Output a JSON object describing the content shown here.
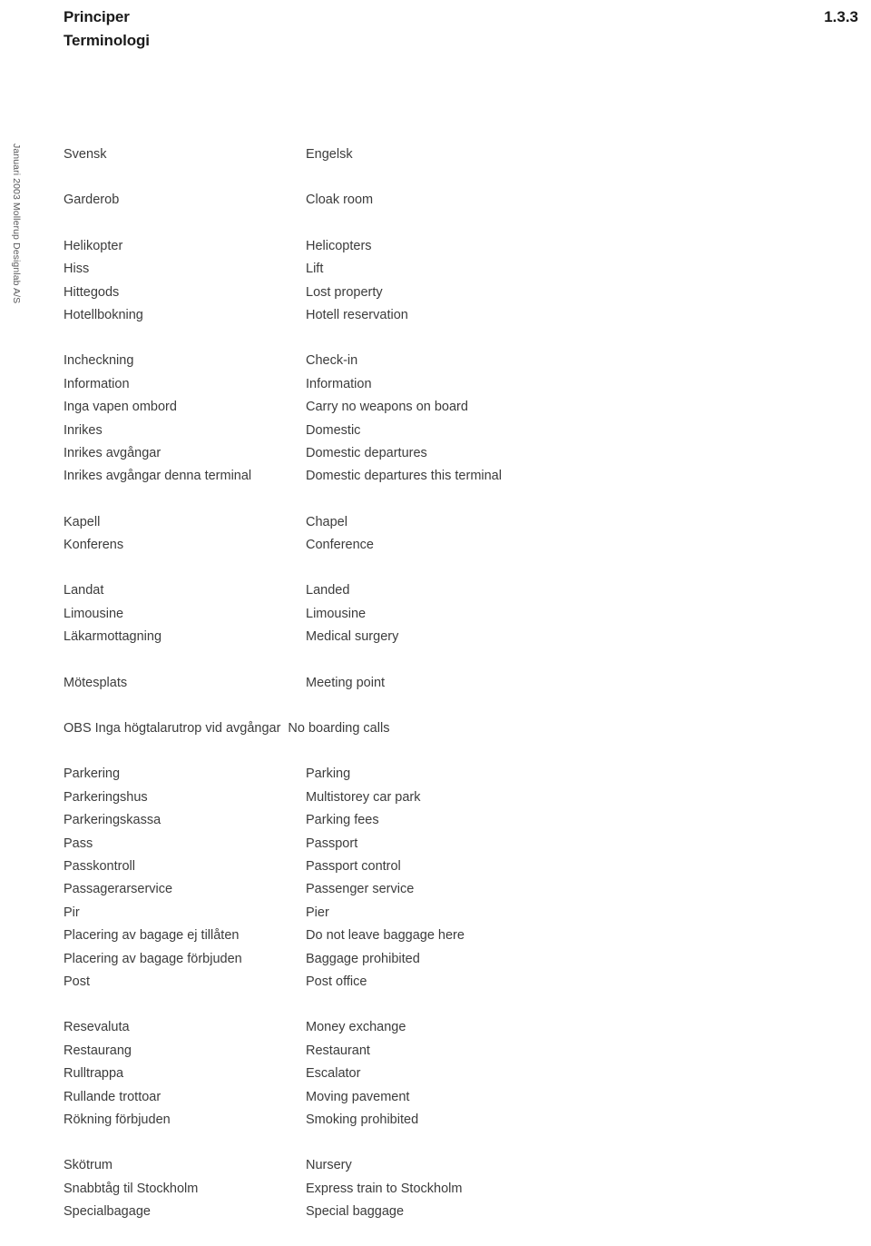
{
  "header": {
    "title": "Principer",
    "subtitle": "Terminologi",
    "page_number": "1.3.3"
  },
  "sidebar": {
    "credit": "Januari 2003  Mollerup Designlab A/S"
  },
  "table": {
    "groups": [
      {
        "rows": [
          {
            "sv": "Svensk",
            "en": "Engelsk"
          }
        ]
      },
      {
        "rows": [
          {
            "sv": "Garderob",
            "en": "Cloak room"
          }
        ]
      },
      {
        "rows": [
          {
            "sv": "Helikopter",
            "en": "Helicopters"
          },
          {
            "sv": "Hiss",
            "en": "Lift"
          },
          {
            "sv": "Hittegods",
            "en": "Lost property"
          },
          {
            "sv": "Hotellbokning",
            "en": "Hotell reservation"
          }
        ]
      },
      {
        "rows": [
          {
            "sv": "Incheckning",
            "en": "Check-in"
          },
          {
            "sv": "Information",
            "en": "Information"
          },
          {
            "sv": "Inga vapen ombord",
            "en": "Carry no weapons on board"
          },
          {
            "sv": "Inrikes",
            "en": "Domestic"
          },
          {
            "sv": "Inrikes avgångar",
            "en": "Domestic departures"
          },
          {
            "sv": "Inrikes avgångar denna terminal",
            "en": "Domestic departures this terminal"
          }
        ]
      },
      {
        "rows": [
          {
            "sv": "Kapell",
            "en": "Chapel"
          },
          {
            "sv": "Konferens",
            "en": "Conference"
          }
        ]
      },
      {
        "rows": [
          {
            "sv": "Landat",
            "en": "Landed"
          },
          {
            "sv": "Limousine",
            "en": "Limousine"
          },
          {
            "sv": "Läkarmottagning",
            "en": "Medical surgery"
          }
        ]
      },
      {
        "rows": [
          {
            "sv": "Mötesplats",
            "en": "Meeting point"
          }
        ]
      },
      {
        "rows": [
          {
            "sv": "OBS Inga högtalarutrop vid avgångar",
            "en": "No boarding calls",
            "wide": true
          }
        ]
      },
      {
        "rows": [
          {
            "sv": "Parkering",
            "en": "Parking"
          },
          {
            "sv": "Parkeringshus",
            "en": "Multistorey car park"
          },
          {
            "sv": "Parkeringskassa",
            "en": "Parking fees"
          },
          {
            "sv": "Pass",
            "en": "Passport"
          },
          {
            "sv": "Passkontroll",
            "en": "Passport control"
          },
          {
            "sv": "Passagerarservice",
            "en": "Passenger service"
          },
          {
            "sv": "Pir",
            "en": "Pier"
          },
          {
            "sv": "Placering av bagage ej tillåten",
            "en": "Do not leave baggage here"
          },
          {
            "sv": "Placering av bagage förbjuden",
            "en": "Baggage prohibited"
          },
          {
            "sv": "Post",
            "en": "Post office"
          }
        ]
      },
      {
        "rows": [
          {
            "sv": "Resevaluta",
            "en": "Money exchange"
          },
          {
            "sv": "Restaurang",
            "en": "Restaurant"
          },
          {
            "sv": "Rulltrappa",
            "en": "Escalator"
          },
          {
            "sv": "Rullande trottoar",
            "en": "Moving pavement"
          },
          {
            "sv": "Rökning förbjuden",
            "en": "Smoking prohibited"
          }
        ]
      },
      {
        "rows": [
          {
            "sv": "Skötrum",
            "en": "Nursery"
          },
          {
            "sv": "Snabbtåg til Stockholm",
            "en": "Express train to Stockholm"
          },
          {
            "sv": "Specialbagage",
            "en": "Special baggage"
          }
        ]
      }
    ]
  },
  "colors": {
    "text": "#3c3c3c",
    "heading": "#1a1a1a",
    "sidebar_text": "#58585a",
    "background": "#ffffff"
  }
}
